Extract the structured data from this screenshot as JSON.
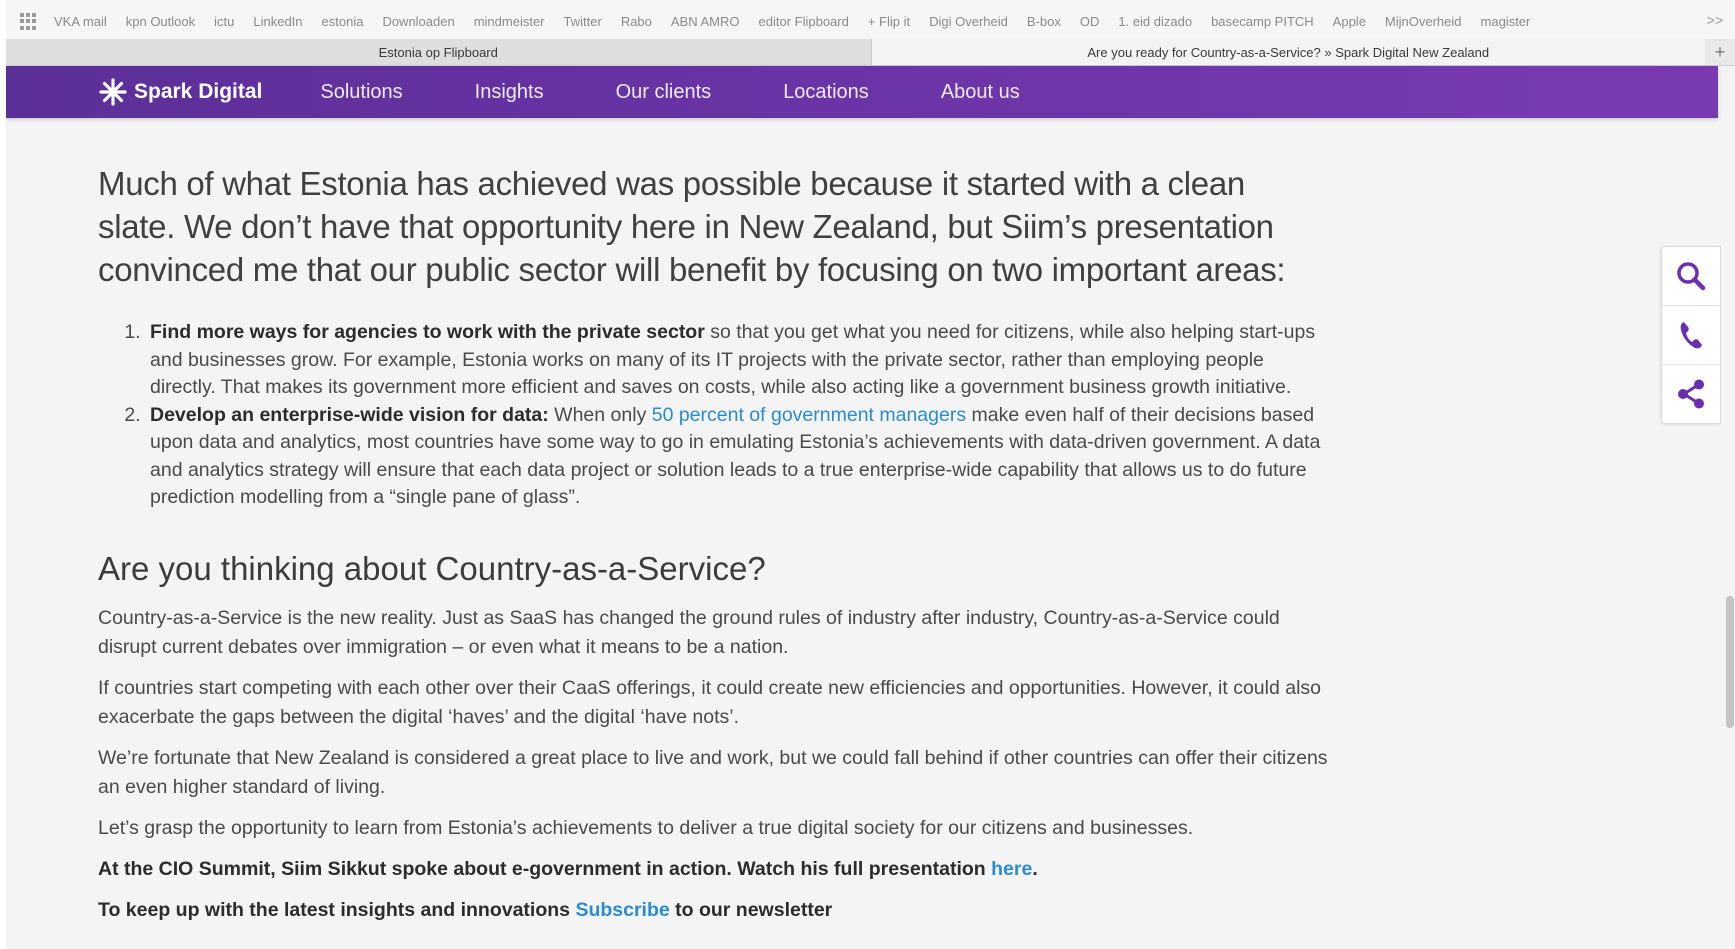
{
  "bookmarks": [
    "VKA mail",
    "kpn Outlook",
    "ictu",
    "LinkedIn",
    "estonia",
    "Downloaden",
    "mindmeister",
    "Twitter",
    "Rabo",
    "ABN AMRO",
    "editor Flipboard",
    "+ Flip it",
    "Digi Overheid",
    "B-box",
    "OD",
    "1. eid dizado",
    "basecamp PITCH",
    "Apple",
    "MijnOverheid",
    "magister"
  ],
  "bookmarks_more": ">>",
  "tabs": {
    "tab1": "Estonia op Flipboard",
    "tab2": "Are you ready for Country-as-a-Service? » Spark Digital New Zealand",
    "add": "+"
  },
  "nav": {
    "brand": "Spark Digital",
    "links": [
      "Solutions",
      "Insights",
      "Our clients",
      "Locations",
      "About us"
    ]
  },
  "article": {
    "lead": "Much of what Estonia has achieved was possible because it started with a clean slate. We don’t have that opportunity here in New Zealand, but Siim’s presentation convinced me that our public sector will benefit by focusing on two important areas:",
    "point1_bold": "Find more ways for agencies to work with the private sector",
    "point1_text": " so that you get what you need for citizens, while also helping start-ups and businesses grow. For example, Estonia works on many of its IT projects with the private sector, rather than employing people directly. That makes its government more efficient and saves on costs, while also acting like a government business growth initiative.",
    "point2_bold": "Develop an enterprise-wide vision for data:",
    "point2_pre": " When only ",
    "point2_link": "50 percent of government managers",
    "point2_post": " make even half of their decisions based upon data and analytics, most countries have some way to go in emulating Estonia’s achievements with data-driven government. A data and analytics strategy will ensure that each data project or solution leads to a true enterprise-wide capability that allows us to do future prediction modelling from a “single pane of glass”.",
    "subhead": "Are you thinking about Country-as-a-Service?",
    "para1": "Country-as-a-Service is the new reality. Just as SaaS has changed the ground rules of industry after industry, Country-as-a-Service could disrupt current debates over immigration – or even what it means to be a nation.",
    "para2": "If countries start competing with each other over their CaaS offerings, it could create new efficiencies and opportunities. However, it could also exacerbate the gaps between the digital ‘haves’ and the digital ‘have nots’.",
    "para3": "We’re fortunate that New Zealand is considered a great place to live and work, but we could fall behind if other countries can offer their citizens an even higher standard of living.",
    "para4": "Let’s grasp the opportunity to learn from Estonia’s achievements to deliver a true digital society for our citizens and businesses.",
    "summit_text": "At the CIO Summit, Siim Sikkut spoke about e-government in action. Watch his full presentation ",
    "summit_link": "here",
    "summit_end": ".",
    "newsletter_pre": "To keep up with the latest insights and innovations ",
    "newsletter_link": "Subscribe",
    "newsletter_post": " to our newsletter"
  },
  "side_buttons": [
    "search-icon",
    "phone-icon",
    "share-icon"
  ],
  "colors": {
    "brand_purple": "#6c35a8",
    "link_blue": "#2a8bd0",
    "icon_purple": "#6a2fb0"
  }
}
